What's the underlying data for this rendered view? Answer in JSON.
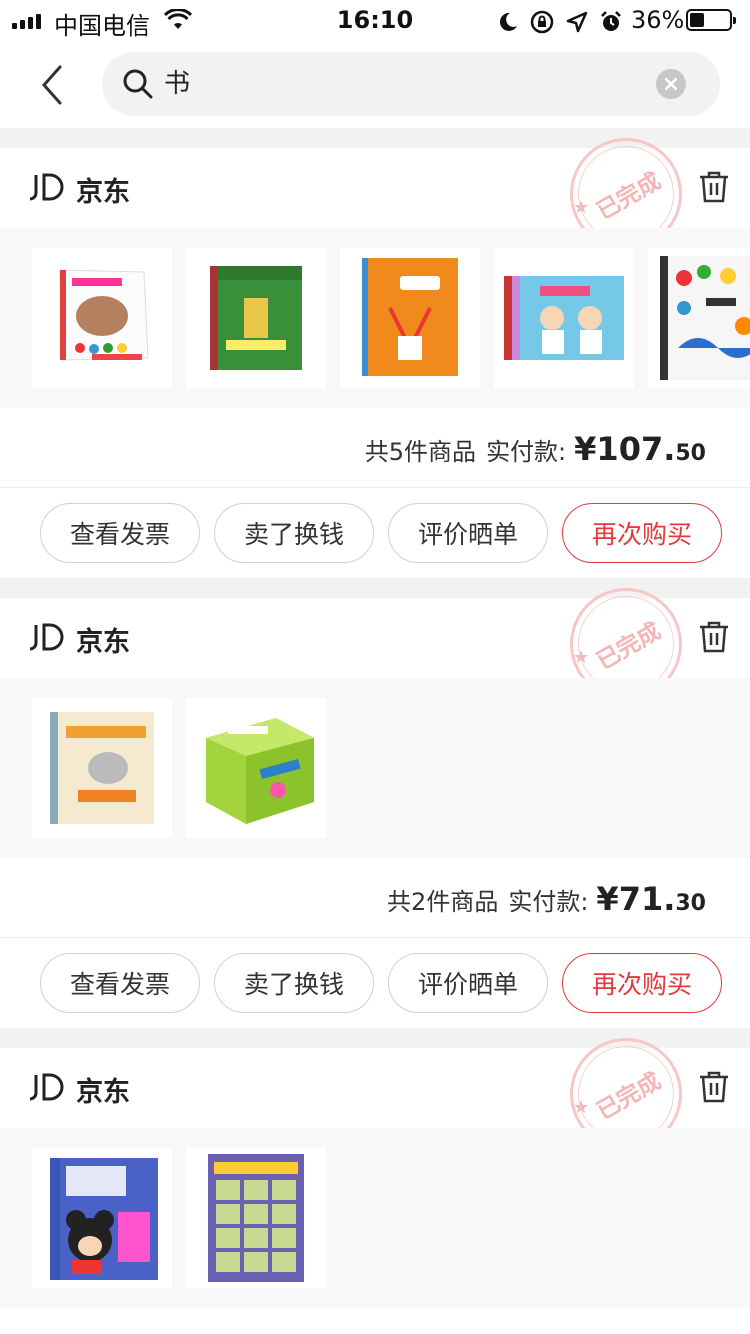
{
  "status_bar": {
    "carrier": "中国电信",
    "time": "16:10",
    "battery_percent": "36%",
    "battery_level": 0.36
  },
  "search": {
    "query": "书"
  },
  "orders": [
    {
      "shop": "京东",
      "stamp": "已完成",
      "items": [
        "book-stone-colors",
        "book-green-cover",
        "book-orange-rabbit",
        "book-body-kids",
        "book-colors-encyclopedia"
      ],
      "summary": {
        "count_text": "共5件商品",
        "paid_label": "实付款:",
        "amount_main": "¥107.",
        "amount_cents": "50"
      },
      "buttons": [
        "查看发票",
        "卖了换钱",
        "评价晒单",
        "再次购买"
      ]
    },
    {
      "shop": "京东",
      "stamp": "已完成",
      "items": [
        "book-elephant-piggie",
        "book-green-box-set"
      ],
      "summary": {
        "count_text": "共2件商品",
        "paid_label": "实付款:",
        "amount_main": "¥71.",
        "amount_cents": "30"
      },
      "buttons": [
        "查看发票",
        "卖了换钱",
        "评价晒单",
        "再次购买"
      ]
    },
    {
      "shop": "京东",
      "stamp": "已完成",
      "items": [
        "book-mickey",
        "book-poster-grid"
      ]
    }
  ],
  "colors": {
    "accent_red": "#e4393c",
    "stamp_pink": "#f4b5b5"
  }
}
